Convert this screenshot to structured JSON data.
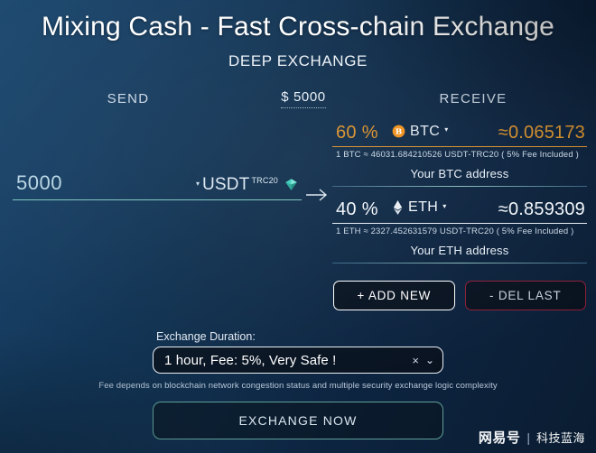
{
  "header": {
    "title": "Mixing Cash - Fast Cross-chain Exchange",
    "subtitle": "DEEP EXCHANGE"
  },
  "columns": {
    "send_label": "SEND",
    "amount_label": "$ 5000",
    "receive_label": "RECEIVE"
  },
  "send": {
    "amount": "5000",
    "currency": "USDT",
    "currency_sup": "TRC20",
    "caret": "▾",
    "token_icon": "usdt-token-icon",
    "arrow_icon": "arrow-right-icon"
  },
  "receive": [
    {
      "percent": "60 %",
      "symbol": "BTC",
      "caret": "▾",
      "icon": "bitcoin-icon",
      "value": "≈0.065173",
      "rate": "1 BTC ≈ 46031.684210526 USDT-TRC20 ( 5% Fee Included )",
      "address_label": "Your BTC address",
      "accent": "#d8912c"
    },
    {
      "percent": "40 %",
      "symbol": "ETH",
      "caret": "▾",
      "icon": "ethereum-icon",
      "value": "≈0.859309",
      "rate": "1 ETH ≈ 2327.452631579 USDT-TRC20 ( 5% Fee Included )",
      "address_label": "Your ETH address",
      "accent": "#e6edf4"
    }
  ],
  "row_buttons": {
    "add_label": "+ ADD NEW",
    "del_label": "- DEL LAST"
  },
  "duration": {
    "label": "Exchange Duration:",
    "value": "1 hour, Fee: 5%, Very Safe !",
    "clear_glyph": "×",
    "caret_glyph": "⌄",
    "options": [
      "1 hour, Fee: 5%, Very Safe !"
    ]
  },
  "fee_note": "Fee depends on blockchain network congestion status and multiple security exchange logic complexity",
  "exchange_button": {
    "label": "EXCHANGE NOW"
  },
  "watermark": {
    "logo": "网易号",
    "separator": "|",
    "text": "科技蓝海"
  }
}
